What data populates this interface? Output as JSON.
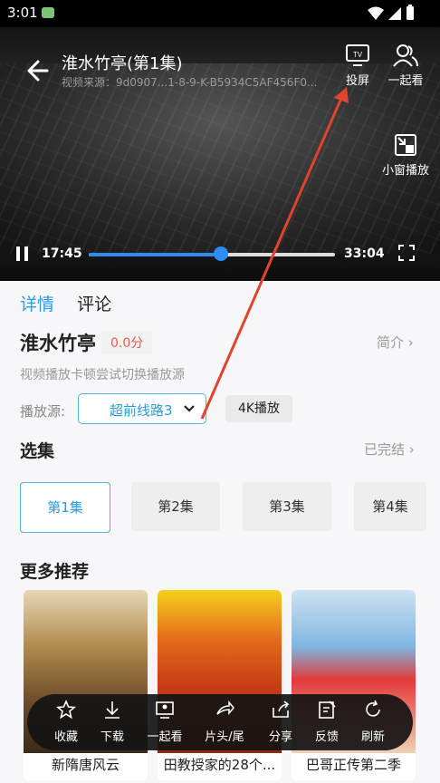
{
  "status_bar": {
    "time": "3:01"
  },
  "player": {
    "title": "淮水竹亭(第1集)",
    "source": "视频来源：9d0907...1-8-9-K-B5934C5AF456F0...",
    "cast_label": "投屏",
    "watch_together_label": "一起看",
    "mini_window_label": "小窗播放",
    "current_time": "17:45",
    "total_time": "33:04",
    "progress": 0.537
  },
  "tabs": [
    {
      "label": "详情"
    },
    {
      "label": "评论"
    }
  ],
  "detail": {
    "title": "淮水竹亭",
    "score": "0.0分",
    "intro_label": "简介",
    "hint": "视频播放卡顿尝试切换播放源",
    "source_label": "播放源:",
    "source_value": "超前线路3",
    "quality_label": "4K播放"
  },
  "episodes": {
    "heading": "选集",
    "status": "已完结",
    "items": [
      "第1集",
      "第2集",
      "第3集",
      "第4集"
    ]
  },
  "recommend": {
    "heading": "更多推荐",
    "items": [
      {
        "name": "新隋唐风云"
      },
      {
        "name": "田教授家的28个..."
      },
      {
        "name": "巴哥正传第二季"
      }
    ]
  },
  "toolbar": {
    "items": [
      "收藏",
      "下载",
      "一起看",
      "片头/尾",
      "分享",
      "反馈",
      "刷新"
    ]
  },
  "colors": {
    "accent": "#2d8cf0",
    "annotation": "#e0442d",
    "score": "#e55a4e"
  }
}
